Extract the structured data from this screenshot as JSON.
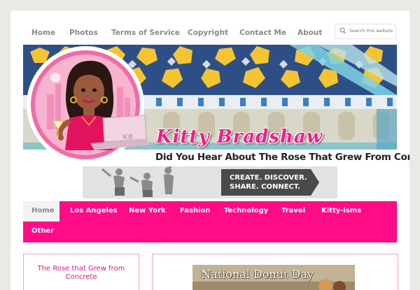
{
  "top_nav": {
    "items": [
      "Home",
      "Photos",
      "Terms of Service",
      "Copyright",
      "Contact Me",
      "About"
    ]
  },
  "search": {
    "placeholder": "Search this website..."
  },
  "header": {
    "site_name": "Kitty Bradshaw",
    "tagline": "Did You Hear About The Rose That Grew From Concrete?",
    "laptop_initials": "KB"
  },
  "ad": {
    "line1": "CREATE. DISCOVER.",
    "line2": "SHARE. CONNECT."
  },
  "main_nav": {
    "items": [
      "Home",
      "Los Angeles",
      "New York",
      "Fashion",
      "Technology",
      "Travel",
      "Kitty-isms",
      "Other"
    ],
    "active": "Home"
  },
  "sidebar_widget": {
    "title": "The Rose that Grew from Concrete"
  },
  "featured_post": {
    "image_text": "National Donut Day"
  },
  "colors": {
    "accent": "#fe0b87",
    "nav_text": "#8a8a8a",
    "background": "#e9e9e6"
  }
}
